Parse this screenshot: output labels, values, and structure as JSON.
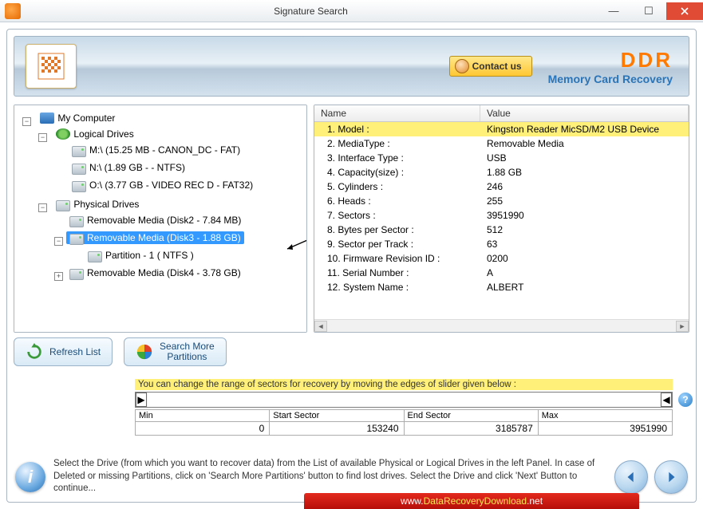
{
  "window": {
    "title": "Signature Search"
  },
  "banner": {
    "contact_label": "Contact us",
    "brand": "DDR",
    "brand_sub": "Memory Card Recovery"
  },
  "tree": {
    "root": "My Computer",
    "logical_label": "Logical Drives",
    "logical": [
      "M:\\ (15.25 MB - CANON_DC - FAT)",
      "N:\\ (1.89 GB -  - NTFS)",
      "O:\\ (3.77 GB - VIDEO REC D - FAT32)"
    ],
    "physical_label": "Physical Drives",
    "physical": [
      "Removable Media (Disk2 - 7.84 MB)",
      "Removable Media (Disk3 - 1.88 GB)",
      "Removable Media (Disk4 - 3.78 GB)"
    ],
    "partition": "Partition - 1 ( NTFS )",
    "selected_index": 1
  },
  "table": {
    "headers": [
      "Name",
      "Value"
    ],
    "rows": [
      {
        "name": "1. Model :",
        "value": "Kingston Reader  MicSD/M2 USB Device",
        "hl": true
      },
      {
        "name": "2. MediaType :",
        "value": "Removable Media"
      },
      {
        "name": "3. Interface Type :",
        "value": "USB"
      },
      {
        "name": "4. Capacity(size) :",
        "value": "1.88 GB"
      },
      {
        "name": "5. Cylinders :",
        "value": "246"
      },
      {
        "name": "6. Heads :",
        "value": "255"
      },
      {
        "name": "7. Sectors :",
        "value": "3951990"
      },
      {
        "name": "8. Bytes per Sector :",
        "value": "512"
      },
      {
        "name": "9. Sector per Track :",
        "value": "63"
      },
      {
        "name": "10. Firmware Revision ID :",
        "value": "0200"
      },
      {
        "name": "11. Serial Number :",
        "value": "A"
      },
      {
        "name": "12. System Name :",
        "value": "ALBERT"
      }
    ]
  },
  "actions": {
    "refresh": "Refresh List",
    "search_more": "Search More\nPartitions"
  },
  "range": {
    "hint": "You can change the range of sectors for recovery by moving the edges of slider given below :",
    "labels": [
      "Min",
      "Start Sector",
      "End Sector",
      "Max"
    ],
    "values": [
      "0",
      "153240",
      "3185787",
      "3951990"
    ]
  },
  "footer": {
    "msg": "Select the Drive (from which you want to recover data) from the List of available Physical or Logical Drives in the left Panel. In case of Deleted or missing Partitions, click on 'Search More Partitions' button to find lost drives. Select the Drive and click 'Next' Button to continue..."
  },
  "redbar": {
    "prefix": "www.",
    "mid": "DataRecoveryDownload",
    "suffix": ".net"
  }
}
